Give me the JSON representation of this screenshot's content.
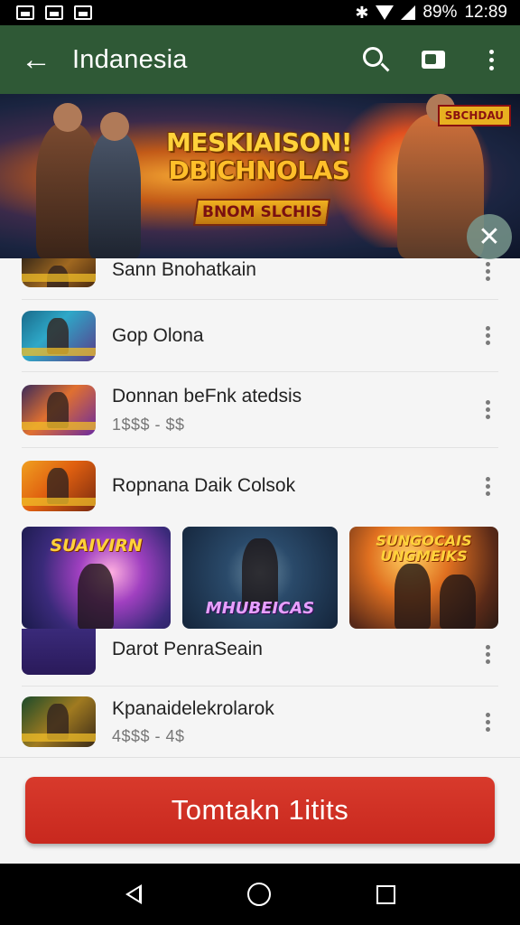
{
  "status_bar": {
    "battery": "89%",
    "time": "12:89"
  },
  "app_bar": {
    "title": "Indanesia"
  },
  "banner": {
    "title_line1": "MESKIAISON!",
    "title_line2": "DBICHNOLAS",
    "ribbon": "BNOM SLCHIS",
    "tag": "SBCHDAU"
  },
  "list": [
    {
      "title": "Sann Bnohatkain",
      "price": ""
    },
    {
      "title": "Gop Olona",
      "price": ""
    },
    {
      "title": "Donnan beFnk atedsis",
      "price": "1$$$ - $$"
    },
    {
      "title": "Ropnana Daik Colsok",
      "price": ""
    },
    {
      "title": "Darot PenraSeain",
      "price": ""
    },
    {
      "title": "Kpanaidelekrolarok",
      "price": "4$$$ - 4$"
    }
  ],
  "tiles": [
    {
      "label": "SUAIVIRN"
    },
    {
      "label": "MHUBEICAS"
    },
    {
      "label": "SUNGOCAIS UNGMEIKS"
    }
  ],
  "cta": {
    "label": "Tomtakn 1itits"
  }
}
